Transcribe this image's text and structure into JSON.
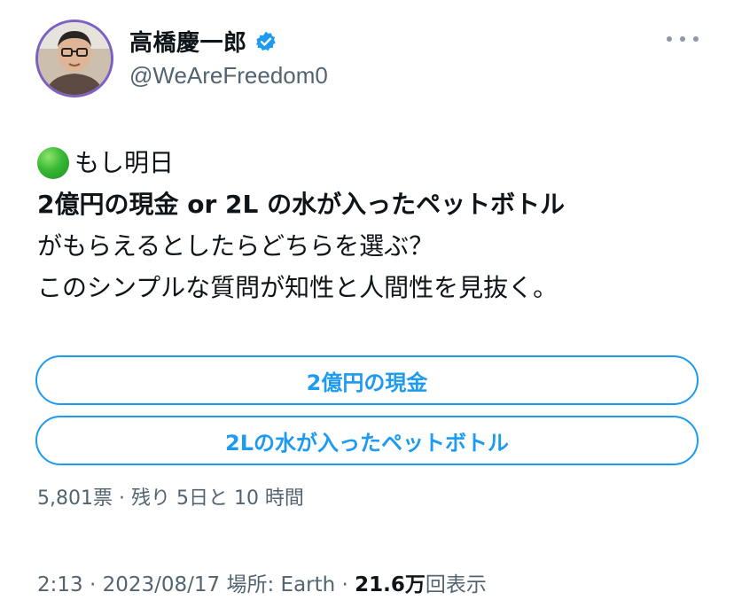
{
  "author": {
    "display_name": "高橋慶一郎",
    "handle": "@WeAreFreedom0",
    "verified": true
  },
  "tweet": {
    "emoji_icon": "green-circle",
    "lines": [
      "もし明日",
      "2億円の現金 or 2L の水が入ったペットボトル",
      "がもらえるとしたらどちらを選ぶ？",
      "このシンプルな質問が知性と人間性を見抜く。"
    ]
  },
  "poll": {
    "options": [
      "2億円の現金",
      "2Lの水が入ったペットボトル"
    ],
    "meta": "5,801票 · 残り 5日と 10 時間"
  },
  "footer": {
    "time": "2:13",
    "separator": " · ",
    "date": "2023/08/17",
    "location_label": "場所: Earth",
    "views_count": "21.6万",
    "views_label": "回表示"
  },
  "colors": {
    "accent": "#1d9bf0",
    "text": "#0f1419",
    "secondary": "#536471",
    "verified": "#1d9bf0",
    "avatar_ring": "#7b61c4"
  }
}
